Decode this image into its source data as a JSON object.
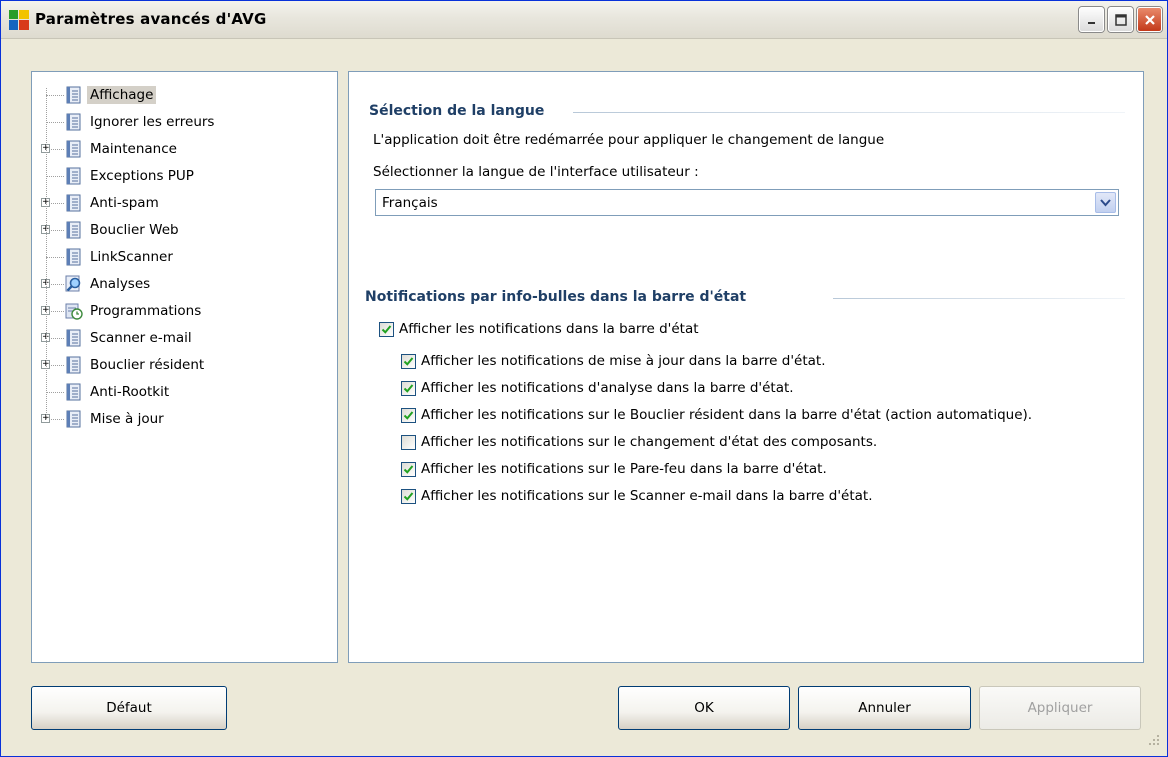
{
  "window": {
    "title": "Paramètres avancés d'AVG",
    "minimize_icon": "minimize-icon",
    "maximize_icon": "maximize-icon",
    "close_icon": "close-icon"
  },
  "tree": {
    "items": [
      {
        "label": "Affichage",
        "expandable": false,
        "icon": "settings-page-icon",
        "selected": true
      },
      {
        "label": "Ignorer les erreurs",
        "expandable": false,
        "icon": "settings-page-icon"
      },
      {
        "label": "Maintenance",
        "expandable": true,
        "icon": "settings-page-icon"
      },
      {
        "label": "Exceptions PUP",
        "expandable": false,
        "icon": "settings-page-icon"
      },
      {
        "label": "Anti-spam",
        "expandable": true,
        "icon": "settings-page-icon"
      },
      {
        "label": "Bouclier Web",
        "expandable": true,
        "icon": "settings-page-icon"
      },
      {
        "label": "LinkScanner",
        "expandable": false,
        "icon": "settings-page-icon"
      },
      {
        "label": "Analyses",
        "expandable": true,
        "icon": "scan-magnifier-icon"
      },
      {
        "label": "Programmations",
        "expandable": true,
        "icon": "schedule-icon"
      },
      {
        "label": "Scanner e-mail",
        "expandable": true,
        "icon": "settings-page-icon"
      },
      {
        "label": "Bouclier résident",
        "expandable": true,
        "icon": "settings-page-icon"
      },
      {
        "label": "Anti-Rootkit",
        "expandable": false,
        "icon": "settings-page-icon"
      },
      {
        "label": "Mise à jour",
        "expandable": true,
        "icon": "settings-page-icon"
      }
    ]
  },
  "language": {
    "section_title": "Sélection de la langue",
    "restart_note": "L'application doit être redémarrée pour appliquer le changement de langue",
    "select_label": "Sélectionner la langue de l'interface utilisateur :",
    "selected_value": "Français"
  },
  "notifications": {
    "section_title": "Notifications par info-bulles dans la barre d'état",
    "master": {
      "label": "Afficher les notifications dans la barre d'état",
      "checked": true
    },
    "options": [
      {
        "label": "Afficher les notifications de mise à jour dans la barre d'état.",
        "checked": true
      },
      {
        "label": "Afficher les notifications d'analyse dans la barre d'état.",
        "checked": true
      },
      {
        "label": "Afficher les notifications sur le Bouclier résident dans la barre d'état (action automatique).",
        "checked": true
      },
      {
        "label": "Afficher les notifications sur le changement d'état des composants.",
        "checked": false
      },
      {
        "label": "Afficher les notifications sur le Pare-feu dans la barre d'état.",
        "checked": true
      },
      {
        "label": "Afficher les notifications sur le Scanner e-mail dans la barre d'état.",
        "checked": true
      }
    ]
  },
  "buttons": {
    "default": "Défaut",
    "ok": "OK",
    "cancel": "Annuler",
    "apply": "Appliquer"
  },
  "colors": {
    "section_title": "#1f3f66",
    "check": "#21a121",
    "title_bar": "#e8e6dd"
  }
}
